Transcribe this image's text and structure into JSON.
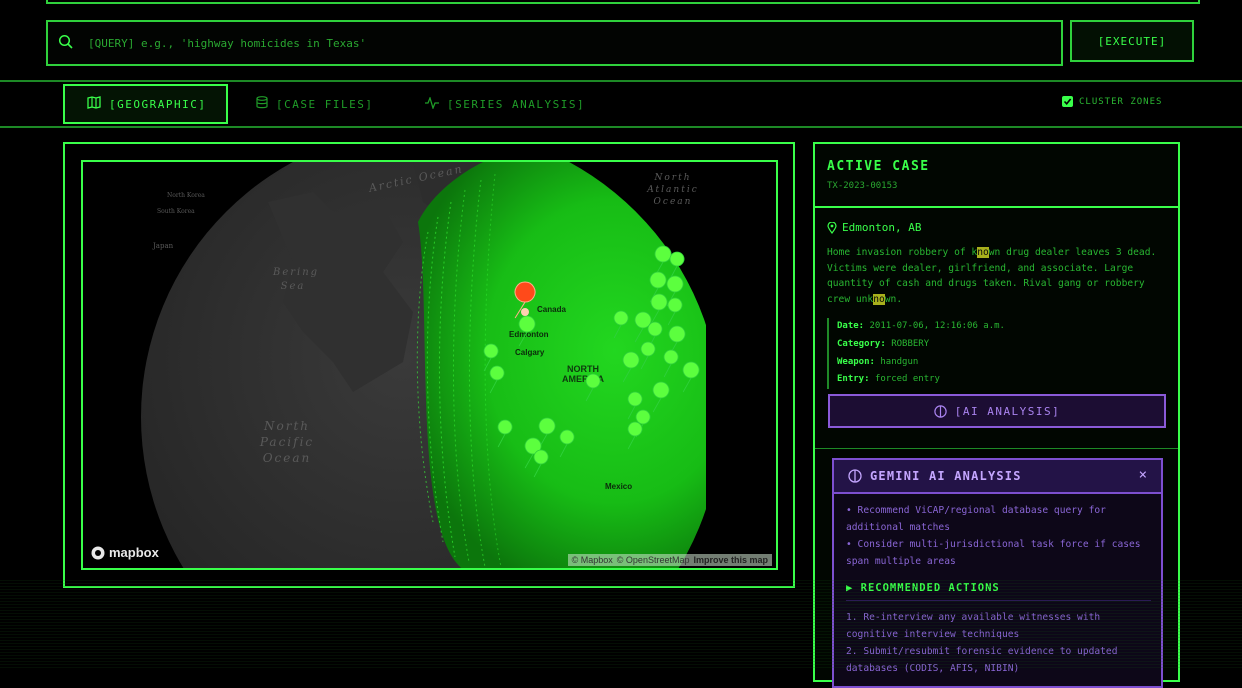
{
  "search": {
    "placeholder": "[QUERY] e.g., 'highway homicides in Texas'",
    "execute_label": "[EXECUTE]"
  },
  "tabs": [
    {
      "label": "[GEOGRAPHIC]",
      "icon": "map-icon",
      "active": true
    },
    {
      "label": "[CASE FILES]",
      "icon": "database-icon",
      "active": false
    },
    {
      "label": "[SERIES ANALYSIS]",
      "icon": "activity-icon",
      "active": false
    }
  ],
  "cluster_zones": {
    "label": "CLUSTER ZONES",
    "checked": true
  },
  "map": {
    "labels": {
      "arctic": "Arctic Ocean",
      "north_atlantic": "North Atlantic Ocean",
      "bering": "Bering Sea",
      "north_pacific": "North Pacific Ocean",
      "north_korea": "North Korea",
      "south_korea": "South Korea",
      "japan": "Japan",
      "north_america": "NORTH AMERICA",
      "canada": "Canada",
      "calgary": "Calgary",
      "edmonton": "Edmonton",
      "mexico": "Mexico"
    },
    "logo": "mapbox",
    "attribution": {
      "mapbox": "© Mapbox",
      "osm": "© OpenStreetMap",
      "improve": "Improve this map"
    },
    "colors": {
      "marker": "#4dff3a",
      "cluster_fill": "#18c81c",
      "selected_marker": "#ff3a1a"
    }
  },
  "active_case": {
    "title": "ACTIVE CASE",
    "id": "TX-2023-00153",
    "location": "Edmonton, AB",
    "desc": {
      "p1": "Home invasion robbery of k",
      "h1": "no",
      "p2": "wn drug dealer leaves 3 dead. Victims were dealer, girlfriend, and associate. Large quantity of cash and drugs taken. Rival gang or robbery crew unk",
      "h2": "no",
      "p3": "wn."
    },
    "meta": [
      {
        "key": "Date:",
        "value": "2011-07-06, 12:16:06 a.m."
      },
      {
        "key": "Category:",
        "value": "ROBBERY"
      },
      {
        "key": "Weapon:",
        "value": "handgun"
      },
      {
        "key": "Entry:",
        "value": "forced entry"
      }
    ],
    "ai_button": "[AI ANALYSIS]"
  },
  "gemini": {
    "title": "GEMINI AI ANALYSIS",
    "close": "×",
    "bullets": [
      "• Recommend ViCAP/regional database query for additional matches",
      "• Consider multi-jurisdictional task force if cases span multiple areas"
    ],
    "actions_title": "▶ RECOMMENDED ACTIONS",
    "actions": [
      "1. Re-interview any available witnesses with cognitive interview techniques",
      "2. Submit/resubmit forensic evidence to updated databases (CODIS, AFIS, NIBIN)"
    ]
  }
}
